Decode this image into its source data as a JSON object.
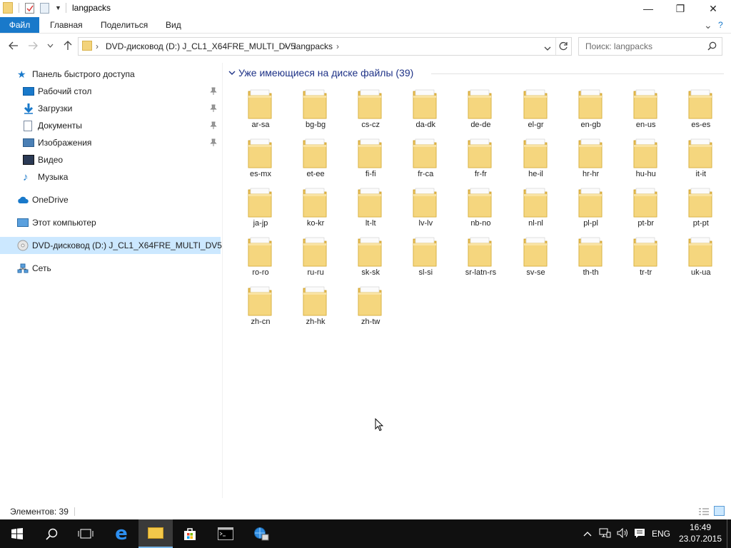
{
  "window": {
    "title": "langpacks",
    "minimize_glyph": "—",
    "maximize_glyph": "❐",
    "close_glyph": "✕"
  },
  "ribbon": {
    "tabs": [
      "Файл",
      "Главная",
      "Поделиться",
      "Вид"
    ],
    "expand_glyph": "⌄",
    "help_glyph": "?"
  },
  "address": {
    "crumbs": [
      "DVD-дисковод (D:) J_CL1_X64FRE_MULTI_DV5",
      "langpacks"
    ],
    "separator": "›"
  },
  "search": {
    "placeholder": "Поиск: langpacks"
  },
  "sidebar": {
    "quick_access": "Панель быстрого доступа",
    "items": [
      {
        "label": "Рабочий стол",
        "icon": "desktop-icon",
        "pinned": true
      },
      {
        "label": "Загрузки",
        "icon": "downloads-icon",
        "pinned": true
      },
      {
        "label": "Документы",
        "icon": "documents-icon",
        "pinned": true
      },
      {
        "label": "Изображения",
        "icon": "pictures-icon",
        "pinned": true
      },
      {
        "label": "Видео",
        "icon": "video-icon",
        "pinned": false
      },
      {
        "label": "Музыка",
        "icon": "music-icon",
        "pinned": false
      }
    ],
    "onedrive": "OneDrive",
    "this_pc": "Этот компьютер",
    "dvd": "DVD-дисковод (D:) J_CL1_X64FRE_MULTI_DV5",
    "network": "Сеть"
  },
  "group": {
    "title": "Уже имеющиеся на диске файлы (39)"
  },
  "folders": [
    "ar-sa",
    "bg-bg",
    "cs-cz",
    "da-dk",
    "de-de",
    "el-gr",
    "en-gb",
    "en-us",
    "es-es",
    "es-mx",
    "et-ee",
    "fi-fi",
    "fr-ca",
    "fr-fr",
    "he-il",
    "hr-hr",
    "hu-hu",
    "it-it",
    "ja-jp",
    "ko-kr",
    "lt-lt",
    "lv-lv",
    "nb-no",
    "nl-nl",
    "pl-pl",
    "pt-br",
    "pt-pt",
    "ro-ro",
    "ru-ru",
    "sk-sk",
    "sl-si",
    "sr-latn-rs",
    "sv-se",
    "th-th",
    "tr-tr",
    "uk-ua",
    "zh-cn",
    "zh-hk",
    "zh-tw"
  ],
  "status": {
    "items_count": "Элементов: 39"
  },
  "taskbar": {
    "lang": "ENG",
    "time": "16:49",
    "date": "23.07.2015"
  },
  "colors": {
    "accent": "#1979ca",
    "selection": "#cce8ff",
    "group_title": "#1e3287",
    "folder": "#f3d37b",
    "taskbar": "#101010"
  }
}
